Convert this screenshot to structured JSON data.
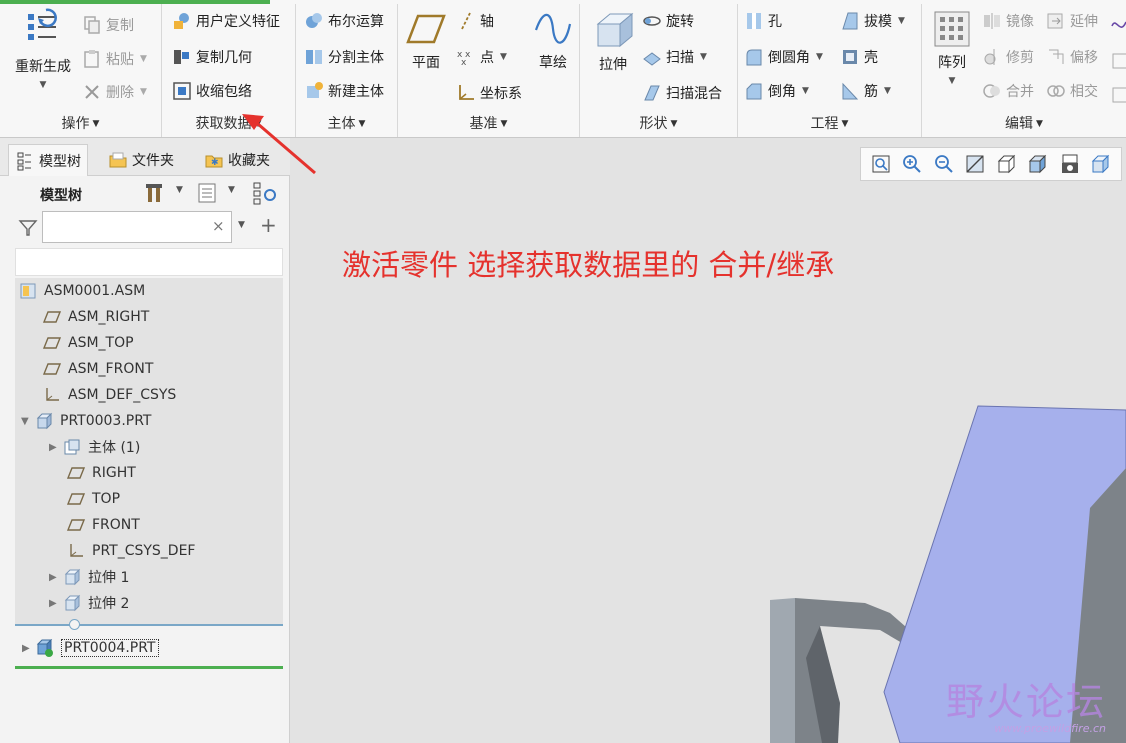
{
  "ribbon": {
    "groups": {
      "operations": {
        "label": "操作",
        "regenerate": "重新生成",
        "copy": "复制",
        "paste": "粘贴",
        "delete": "删除"
      },
      "get_data": {
        "label": "获取数据",
        "user_defined_feature": "用户定义特征",
        "copy_geometry": "复制几何",
        "shrinkwrap": "收缩包络"
      },
      "body": {
        "label": "主体",
        "boolean": "布尔运算",
        "split_body": "分割主体",
        "new_body": "新建主体"
      },
      "datum": {
        "label": "基准",
        "plane": "平面",
        "axis": "轴",
        "point": "点",
        "csys": "坐标系",
        "sketch": "草绘"
      },
      "shapes": {
        "label": "形状",
        "extrude": "拉伸",
        "revolve": "旋转",
        "sweep": "扫描",
        "swept_blend": "扫描混合"
      },
      "engineering": {
        "label": "工程",
        "hole": "孔",
        "draft": "拔模",
        "round": "倒圆角",
        "shell": "壳",
        "chamfer": "倒角",
        "rib": "筋"
      },
      "editing": {
        "label": "编辑",
        "pattern": "阵列",
        "mirror": "镜像",
        "extend": "延伸",
        "trim": "修剪",
        "offset": "偏移",
        "merge": "合并",
        "intersect": "相交"
      }
    }
  },
  "left_panel": {
    "tabs": [
      "模型树",
      "文件夹",
      "收藏夹"
    ],
    "tree_title": "模型树",
    "search": {
      "value": "",
      "placeholder": ""
    },
    "tree": [
      {
        "label": "ASM0001.ASM",
        "icon": "assembly-icon"
      },
      {
        "label": "ASM_RIGHT",
        "icon": "datum-plane-icon"
      },
      {
        "label": "ASM_TOP",
        "icon": "datum-plane-icon"
      },
      {
        "label": "ASM_FRONT",
        "icon": "datum-plane-icon"
      },
      {
        "label": "ASM_DEF_CSYS",
        "icon": "csys-icon"
      },
      {
        "label": "PRT0003.PRT",
        "icon": "part-icon"
      },
      {
        "label": "主体 (1)",
        "icon": "body-icon"
      },
      {
        "label": "RIGHT",
        "icon": "datum-plane-icon"
      },
      {
        "label": "TOP",
        "icon": "datum-plane-icon"
      },
      {
        "label": "FRONT",
        "icon": "datum-plane-icon"
      },
      {
        "label": "PRT_CSYS_DEF",
        "icon": "csys-icon"
      },
      {
        "label": "拉伸 1",
        "icon": "extrude-icon"
      },
      {
        "label": "拉伸 2",
        "icon": "extrude-icon"
      },
      {
        "label": "PRT0004.PRT",
        "icon": "active-part-icon"
      }
    ]
  },
  "viewport": {
    "annotation": "激活零件 选择获取数据里的  合并/继承",
    "watermark": {
      "title": "野火论坛",
      "url": "www.proewildfire.cn"
    }
  },
  "colors": {
    "annotation": "#e5322d",
    "arrow": "#e5322d",
    "model_face_blue": "#a6b0ec",
    "model_face_gray": "#7d8389",
    "active_underline": "#4caf50"
  }
}
